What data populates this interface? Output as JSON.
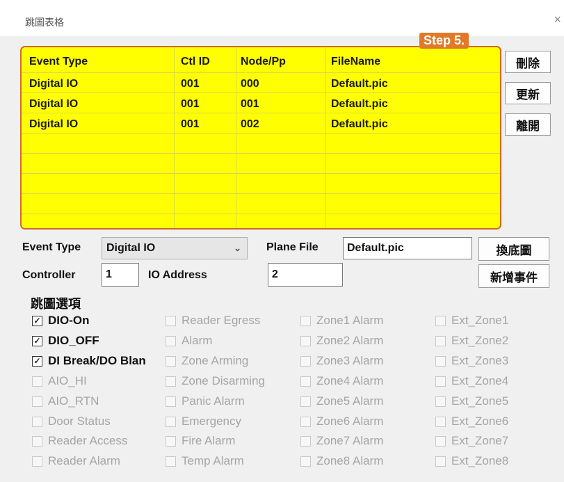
{
  "window": {
    "title": "跳圖表格",
    "close": "×"
  },
  "annotation": {
    "step": "Step 5."
  },
  "table": {
    "headers": [
      "Event Type",
      "Ctl ID",
      "Node/Pp",
      "FileName"
    ],
    "rows": [
      [
        "Digital IO",
        "001",
        "000",
        "Default.pic"
      ],
      [
        "Digital IO",
        "001",
        "001",
        "Default.pic"
      ],
      [
        "Digital IO",
        "001",
        "002",
        "Default.pic"
      ]
    ]
  },
  "side_buttons": {
    "delete": "刪除",
    "update": "更新",
    "exit": "離開"
  },
  "form": {
    "event_type_label": "Event Type",
    "event_type_value": "Digital IO",
    "plane_file_label": "Plane File",
    "plane_file_value": "Default.pic",
    "change_map_button": "換底圖",
    "controller_label": "Controller",
    "controller_value": "1",
    "io_address_label": "IO Address",
    "io_address_value": "2",
    "add_event_button": "新增事件"
  },
  "options": {
    "title": "跳圖選項",
    "columns": [
      [
        {
          "label": "DIO-On",
          "checked": true,
          "enabled": true
        },
        {
          "label": "DIO_OFF",
          "checked": true,
          "enabled": true
        },
        {
          "label": "DI Break/DO Blan",
          "checked": true,
          "enabled": true
        },
        {
          "label": "AIO_HI",
          "checked": false,
          "enabled": false
        },
        {
          "label": "AIO_RTN",
          "checked": false,
          "enabled": false
        },
        {
          "label": "Door Status",
          "checked": false,
          "enabled": false
        },
        {
          "label": "Reader Access",
          "checked": false,
          "enabled": false
        },
        {
          "label": "Reader Alarm",
          "checked": false,
          "enabled": false
        }
      ],
      [
        {
          "label": "Reader Egress",
          "checked": false,
          "enabled": false
        },
        {
          "label": "Alarm",
          "checked": false,
          "enabled": false
        },
        {
          "label": "Zone Arming",
          "checked": false,
          "enabled": false
        },
        {
          "label": "Zone Disarming",
          "checked": false,
          "enabled": false
        },
        {
          "label": "Panic Alarm",
          "checked": false,
          "enabled": false
        },
        {
          "label": "Emergency",
          "checked": false,
          "enabled": false
        },
        {
          "label": "Fire Alarm",
          "checked": false,
          "enabled": false
        },
        {
          "label": "Temp Alarm",
          "checked": false,
          "enabled": false
        }
      ],
      [
        {
          "label": "Zone1 Alarm",
          "checked": false,
          "enabled": false
        },
        {
          "label": "Zone2 Alarm",
          "checked": false,
          "enabled": false
        },
        {
          "label": "Zone3 Alarm",
          "checked": false,
          "enabled": false
        },
        {
          "label": "Zone4 Alarm",
          "checked": false,
          "enabled": false
        },
        {
          "label": "Zone5 Alarm",
          "checked": false,
          "enabled": false
        },
        {
          "label": "Zone6 Alarm",
          "checked": false,
          "enabled": false
        },
        {
          "label": "Zone7 Alarm",
          "checked": false,
          "enabled": false
        },
        {
          "label": "Zone8 Alarm",
          "checked": false,
          "enabled": false
        }
      ],
      [
        {
          "label": "Ext_Zone1",
          "checked": false,
          "enabled": false
        },
        {
          "label": "Ext_Zone2",
          "checked": false,
          "enabled": false
        },
        {
          "label": "Ext_Zone3",
          "checked": false,
          "enabled": false
        },
        {
          "label": "Ext_Zone4",
          "checked": false,
          "enabled": false
        },
        {
          "label": "Ext_Zone5",
          "checked": false,
          "enabled": false
        },
        {
          "label": "Ext_Zone6",
          "checked": false,
          "enabled": false
        },
        {
          "label": "Ext_Zone7",
          "checked": false,
          "enabled": false
        },
        {
          "label": "Ext_Zone8",
          "checked": false,
          "enabled": false
        }
      ]
    ]
  },
  "colors": {
    "highlight": "#ffff00",
    "highlight_border": "#d06a2a",
    "step_badge": "#e07a2a",
    "disabled_text": "#a5a5a5"
  },
  "icons": {
    "close": "close-icon",
    "dropdown": "chevron-down-icon",
    "check": "check-icon"
  }
}
